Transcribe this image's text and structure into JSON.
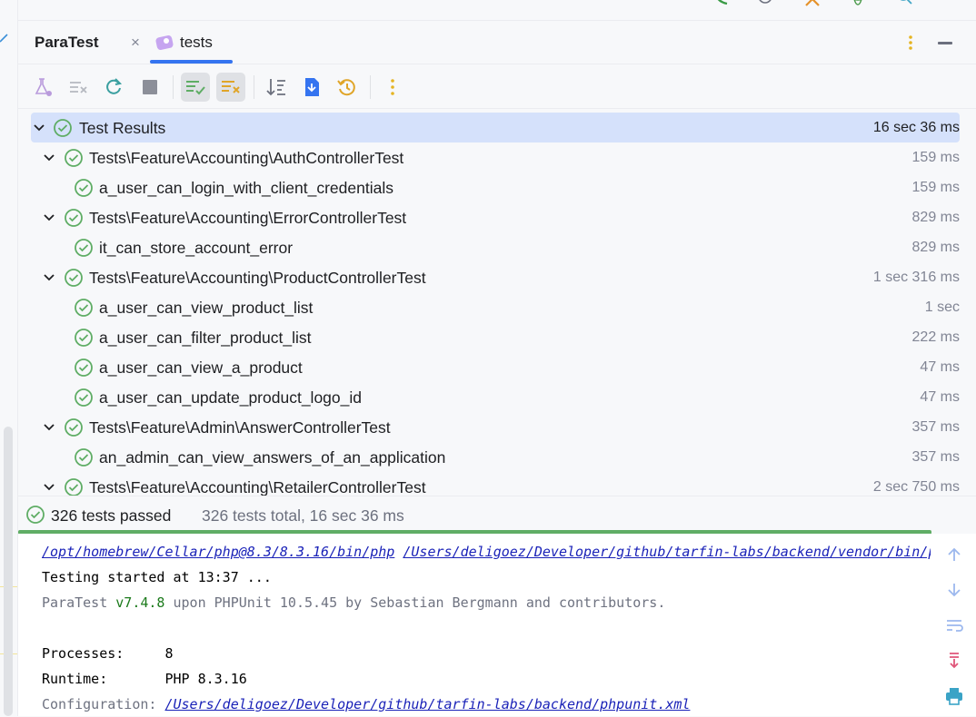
{
  "colors": {
    "accent": "#3574f0",
    "pass": "#5fad65",
    "selection": "#d5e1fb",
    "link": "#1a22b8"
  },
  "tool_window": {
    "title": "ParaTest",
    "tab": {
      "label": "tests",
      "icon": "php-test-icon",
      "closable": true
    }
  },
  "toolbar": {
    "buttons": [
      {
        "name": "run-tests-icon",
        "active": false
      },
      {
        "name": "rerun-failed-icon",
        "active": false
      },
      {
        "name": "rerun-icon",
        "active": false
      },
      {
        "name": "stop-icon",
        "active": false
      },
      {
        "name": "show-passed-icon",
        "active": true
      },
      {
        "name": "show-ignored-icon",
        "active": true
      },
      {
        "name": "sort-icon",
        "active": false
      },
      {
        "name": "import-tests-icon",
        "active": false
      },
      {
        "name": "history-icon",
        "active": false
      },
      {
        "name": "more-icon",
        "active": false
      }
    ]
  },
  "tree": {
    "rows": [
      {
        "label": "Test Results",
        "duration": "16 sec 36 ms",
        "level": 0,
        "expandable": true,
        "selected": true
      },
      {
        "label": "Tests\\Feature\\Accounting\\AuthControllerTest",
        "duration": "159 ms",
        "level": 1,
        "expandable": true
      },
      {
        "label": "a_user_can_login_with_client_credentials",
        "duration": "159 ms",
        "level": 2,
        "expandable": false
      },
      {
        "label": "Tests\\Feature\\Accounting\\ErrorControllerTest",
        "duration": "829 ms",
        "level": 1,
        "expandable": true
      },
      {
        "label": "it_can_store_account_error",
        "duration": "829 ms",
        "level": 2,
        "expandable": false
      },
      {
        "label": "Tests\\Feature\\Accounting\\ProductControllerTest",
        "duration": "1 sec 316 ms",
        "level": 1,
        "expandable": true
      },
      {
        "label": "a_user_can_view_product_list",
        "duration": "1 sec",
        "level": 2,
        "expandable": false
      },
      {
        "label": "a_user_can_filter_product_list",
        "duration": "222 ms",
        "level": 2,
        "expandable": false
      },
      {
        "label": "a_user_can_view_a_product",
        "duration": "47 ms",
        "level": 2,
        "expandable": false
      },
      {
        "label": "a_user_can_update_product_logo_id",
        "duration": "47 ms",
        "level": 2,
        "expandable": false
      },
      {
        "label": "Tests\\Feature\\Admin\\AnswerControllerTest",
        "duration": "357 ms",
        "level": 1,
        "expandable": true
      },
      {
        "label": "an_admin_can_view_answers_of_an_application",
        "duration": "357 ms",
        "level": 2,
        "expandable": false
      },
      {
        "label": "Tests\\Feature\\Accounting\\RetailerControllerTest",
        "duration": "2 sec 750 ms",
        "level": 1,
        "expandable": true
      }
    ]
  },
  "status": {
    "passed": "326 tests passed",
    "summary": "326 tests total, 16 sec 36 ms",
    "progress": 1.0
  },
  "console": {
    "cmd_php": "/opt/homebrew/Cellar/php@8.3/8.3.16/bin/php",
    "cmd_vendor": "/Users/deligoez/Developer/github/tarfin-labs/backend/vendor/bin/paratest",
    "started": "Testing started at 13:37 ...",
    "paratest_name": "ParaTest ",
    "paratest_version": "v7.4.8",
    "paratest_rest": " upon PHPUnit 10.5.45 by Sebastian Bergmann and contributors.",
    "processes_label": "Processes:     ",
    "processes_value": "8",
    "runtime_label": "Runtime:       ",
    "runtime_value": "PHP 8.3.16",
    "config_label": "Configuration: ",
    "config_value": "/Users/deligoez/Developer/github/tarfin-labs/backend/phpunit.xml"
  }
}
